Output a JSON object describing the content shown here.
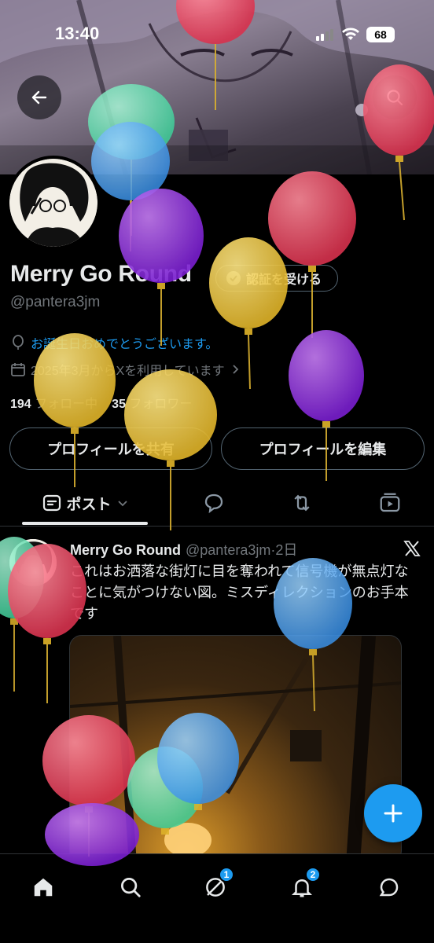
{
  "status_bar": {
    "time": "13:40",
    "battery": "68"
  },
  "profile": {
    "display_name": "Merry Go Round",
    "handle": "@pantera3jm",
    "verify_label": "認証を受ける",
    "birthday_text": "お誕生日おめでとうございます。",
    "joined_text": "2025年3月からXを利用しています",
    "following_count": "194",
    "following_label": "フォロー中",
    "followers_count": "35",
    "followers_label": "フォロワー",
    "share_label": "プロフィールを共有",
    "edit_label": "プロフィールを編集"
  },
  "tabs": {
    "posts_label": "ポスト"
  },
  "post": {
    "name": "Merry Go Round",
    "meta": "@pantera3jm·2日",
    "text": "これはお洒落な街灯に目を奪われて信号機が無点灯なことに気がつけない図。ミスディレクションのお手本です"
  },
  "nav": {
    "messages_badge": "1",
    "notifications_badge": "2"
  },
  "colors": {
    "accent": "#1d9bf0",
    "background": "#000000",
    "text": "#e7e9ea",
    "muted": "#71767b"
  }
}
